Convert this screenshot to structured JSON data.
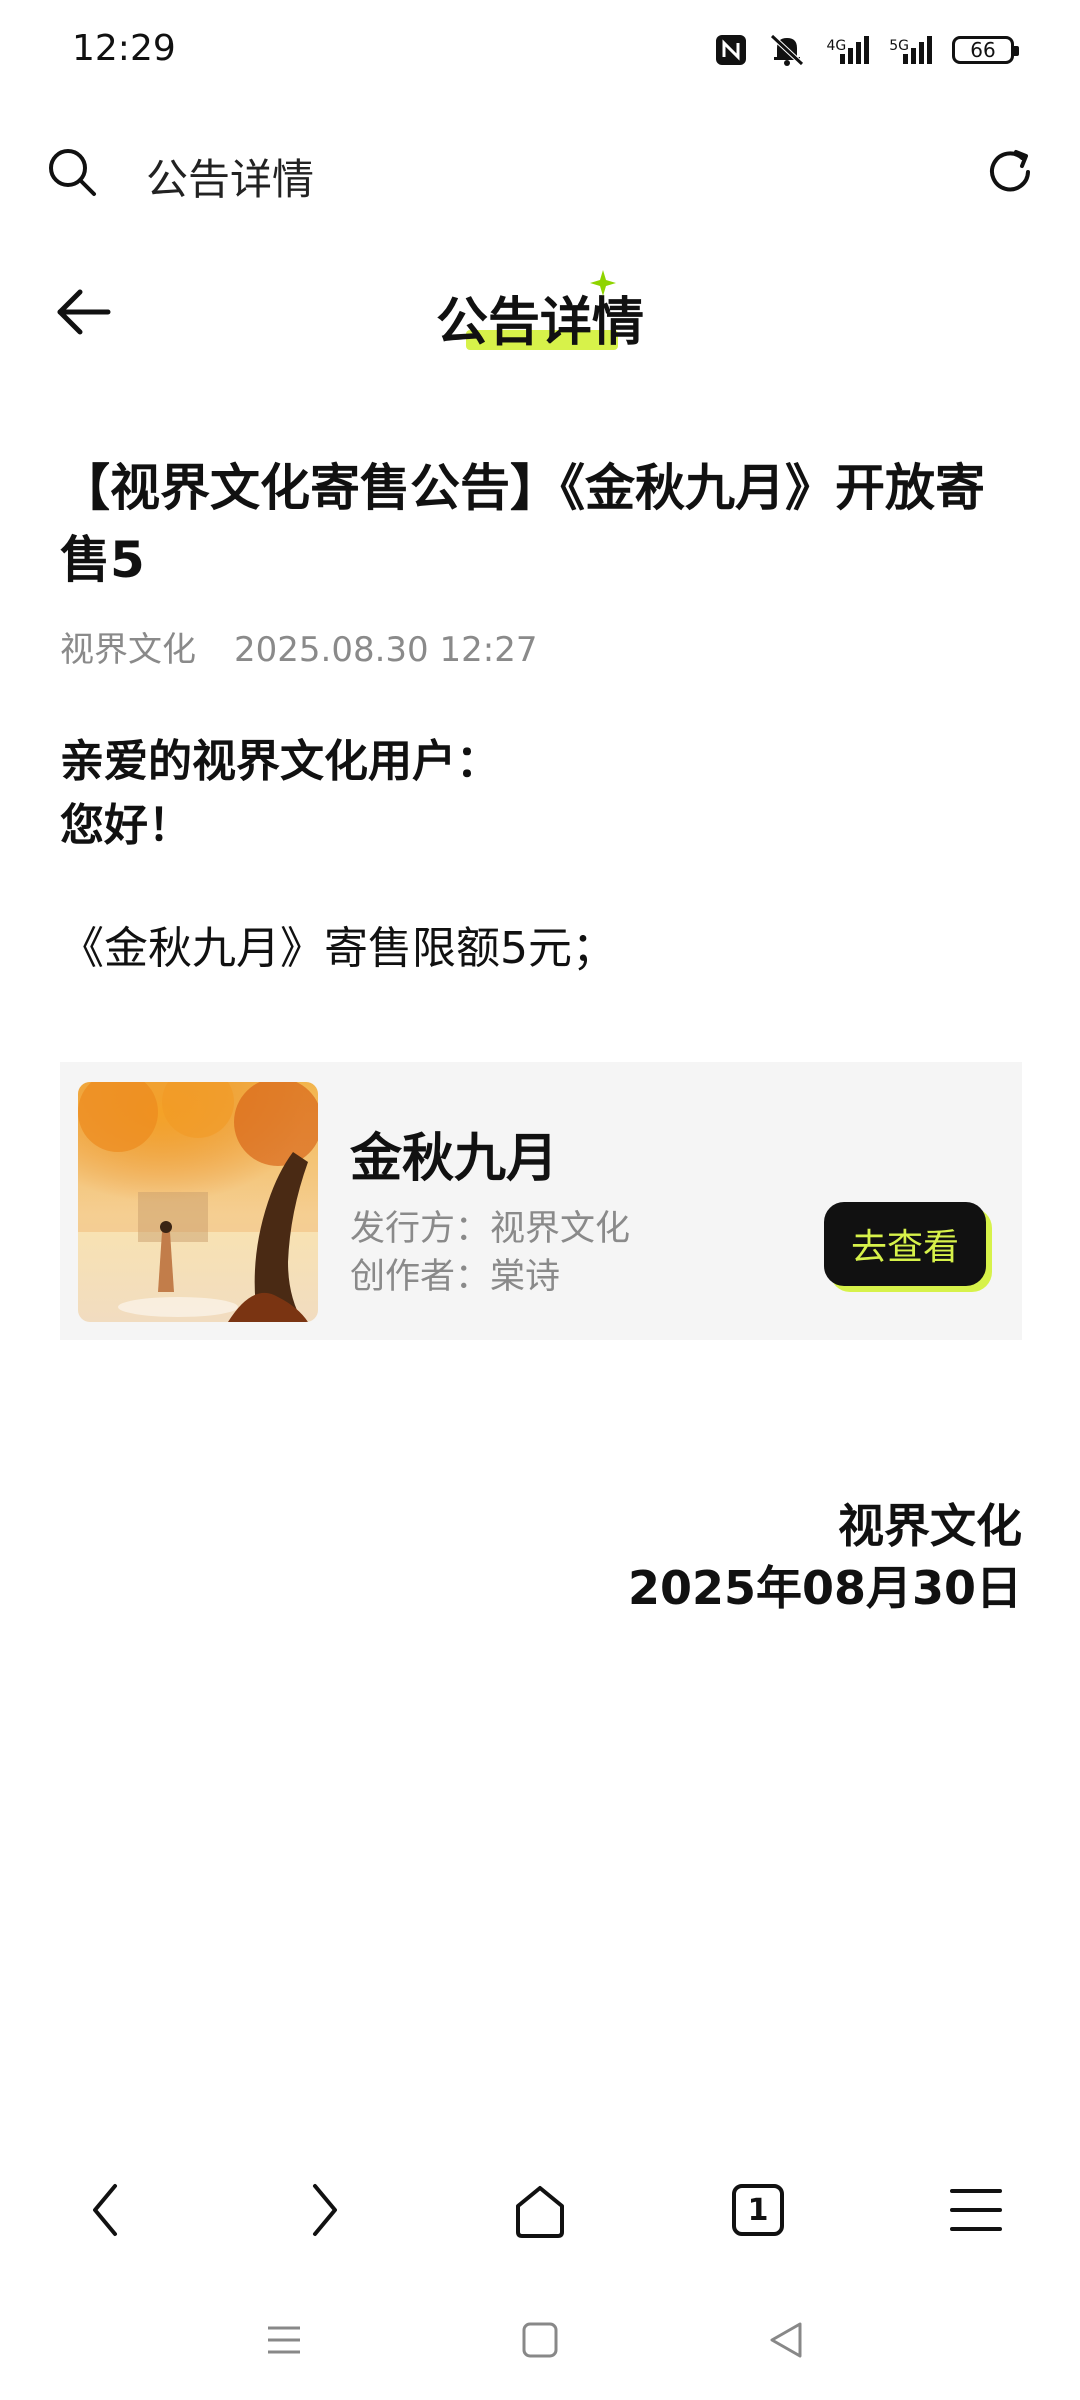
{
  "status_bar": {
    "time": "12:29",
    "net1": "4G",
    "net2": "5G",
    "battery": "66"
  },
  "browser": {
    "url_text": "公告详情",
    "icons": [
      "search-icon",
      "refresh-icon"
    ]
  },
  "header": {
    "title": "公告详情",
    "accent_color": "#d7f24a"
  },
  "article": {
    "title": "【视界文化寄售公告】《金秋九月》开放寄售5",
    "publisher": "视界文化",
    "datetime": "2025.08.30 12:27",
    "greeting_line1": "亲爱的视界文化用户：",
    "greeting_line2": "您好！",
    "body": "《金秋九月》寄售限额5元；"
  },
  "card": {
    "name": "金秋九月",
    "publisher_label": "发行方：视界文化",
    "author_label": "创作者：棠诗",
    "button_label": "去查看"
  },
  "signature": {
    "name": "视界文化",
    "date": "2025年08月30日"
  },
  "bottom_nav": {
    "tab_count": "1",
    "icons": [
      "back-icon",
      "forward-icon",
      "home-icon",
      "tabs-icon",
      "menu-icon"
    ]
  },
  "system_nav": {
    "icons": [
      "recents-icon",
      "home-square-icon",
      "back-triangle-icon"
    ]
  }
}
